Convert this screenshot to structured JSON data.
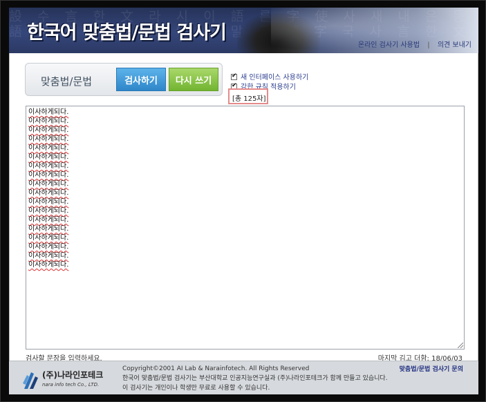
{
  "header": {
    "title": "한국어 맞춤법/문법 검사기",
    "links": [
      "온라인 검사기 사용법",
      "의견 보내기"
    ],
    "separator": "|"
  },
  "toolbox": {
    "label": "맞춤법/문법",
    "check_button": "검사하기",
    "rewrite_button": "다시 쓰기"
  },
  "options": {
    "new_ui": {
      "label": "새 인터페이스 사용하기",
      "checked": true
    },
    "strict": {
      "label": "강한 규칙 적용하기",
      "checked": true
    }
  },
  "char_count": "[총 125자]",
  "editor": {
    "lines": [
      "이사하게되다.",
      "이사하게되다.",
      "이사하게되다.",
      "이사하게되다.",
      "이사하게되다.",
      "이사하게되다.",
      "이사하게되다.",
      "이사하게되다.",
      "이사하게되다.",
      "이사하게되다.",
      "이사하게되다.",
      "이사하게되다.",
      "이사하게되다.",
      "이사하게되다.",
      "이사하게되다.",
      "이사하게되다.",
      "이사하게되다.",
      "이사하게되다."
    ]
  },
  "hints": {
    "left": "검사할 문장을 입력하세요.",
    "right": "마지막 김고 더함: 18/06/03"
  },
  "footer": {
    "company_name": "(주)나라인포테크",
    "company_sub": "nara info tech Co., LTD.",
    "copyright": "Copyright©2001 AI Lab & Narainfotech. All Rights Reserved",
    "line2": "한국어 맞춤법/문법 검사기는 부산대학교 인공지능연구실과 (주)나라인포테크가 함께 만들고 있습니다.",
    "line3": "이 검사기는 개인이나 학생만 무료로 사용할 수 있습니다.",
    "contact": "맞춤법/문법 검사기 문의"
  },
  "colors": {
    "header_bg": "#2b3964",
    "check_button": "#3a94d6",
    "rewrite_button": "#84c13f",
    "count_highlight": "#e58a8a",
    "link": "#2c3f8f"
  }
}
